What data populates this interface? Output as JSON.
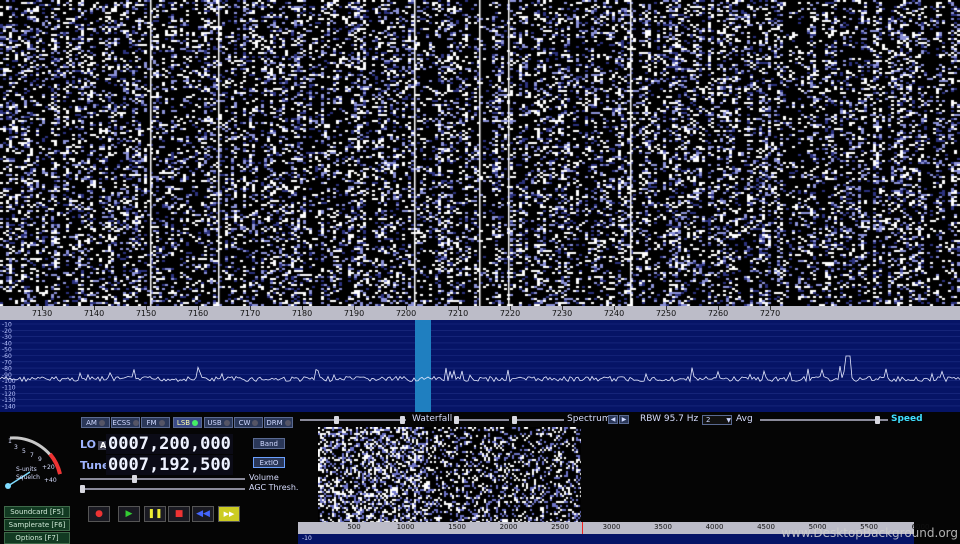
{
  "frequency_scale": {
    "labels": [
      "7130",
      "7140",
      "7150",
      "7160",
      "7170",
      "7180",
      "7190",
      "7200",
      "7210",
      "7220",
      "7230",
      "7240",
      "7250",
      "7260",
      "7270"
    ]
  },
  "spectrum": {
    "db_labels": [
      "-10",
      "-20",
      "-30",
      "-40",
      "-50",
      "-60",
      "-70",
      "-80",
      "-90",
      "-100",
      "-110",
      "-120",
      "-130",
      "-140"
    ]
  },
  "modes": [
    {
      "label": "AM",
      "active": false
    },
    {
      "label": "ECSS",
      "active": false
    },
    {
      "label": "FM",
      "active": false
    },
    {
      "label": "LSB",
      "active": true
    },
    {
      "label": "USB",
      "active": false
    },
    {
      "label": "CW",
      "active": false
    },
    {
      "label": "DRM",
      "active": false
    }
  ],
  "lo": {
    "label": "LO",
    "marker": "A",
    "value": "0007,200,000"
  },
  "tune": {
    "label": "Tune",
    "value": "0007,192,500"
  },
  "band_button": "Band",
  "extio_button": "ExtIO",
  "volume_label": "Volume",
  "agc_label": "AGC Thresh.",
  "smeter": {
    "label1": "S-units",
    "label2": "Squelch",
    "scale": [
      "1",
      "3",
      "5",
      "7",
      "9",
      "+20",
      "+40"
    ]
  },
  "side_buttons": [
    "Soundcard [F5]",
    "Samplerate [F6]",
    "Options   [F7]"
  ],
  "header": {
    "waterfall": "Waterfall",
    "spectrum": "Spectrum",
    "rbw": "RBW 95.7 Hz",
    "avg_value": "2",
    "avg": "Avg",
    "speed": "Speed"
  },
  "audio_scale": {
    "labels": [
      "500",
      "1000",
      "1500",
      "2000",
      "2500",
      "3000",
      "3500",
      "4000",
      "4500",
      "5000",
      "5500",
      "6000"
    ],
    "left": "-10"
  },
  "watermark": "www.DesktopBackground.org",
  "colors": {
    "waterfall_bg": "#000000",
    "spectrum_bg": "#061466",
    "highlight": "#1f7fc0"
  }
}
